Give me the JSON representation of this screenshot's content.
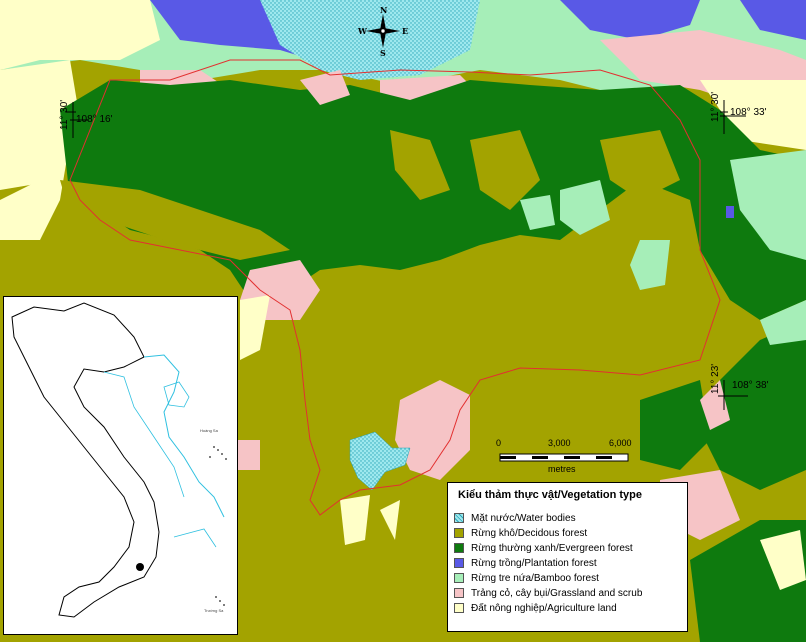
{
  "legend": {
    "title": "Kiểu thảm thực vật/Vegetation type",
    "items": [
      {
        "label": "Mặt nước/Water bodies",
        "color": "#9ee8ee",
        "pattern": "dotted"
      },
      {
        "label": "Rừng khô/Decidous forest",
        "color": "#a3a300"
      },
      {
        "label": "Rừng thường xanh/Evergreen forest",
        "color": "#0e7a0e"
      },
      {
        "label": "Rừng trồng/Plantation forest",
        "color": "#5959e6"
      },
      {
        "label": "Rừng tre nứa/Bamboo forest",
        "color": "#a6eeb8"
      },
      {
        "label": "Trảng cỏ, cây bụi/Grassland and scrub",
        "color": "#f6c4c6"
      },
      {
        "label": "Đất nông nghiệp/Agriculture land",
        "color": "#ffffc8"
      }
    ]
  },
  "coordinates": {
    "nw_lat": "11° 30'",
    "nw_lon": "108° 16'",
    "ne_lat": "11° 30'",
    "ne_lon": "108° 33'",
    "se_lat": "11° 23'",
    "se_lon": "108° 38'"
  },
  "scale": {
    "ticks": [
      "0",
      "3,000",
      "6,000"
    ],
    "unit": "metres"
  },
  "compass": {
    "n": "N",
    "s": "S",
    "e": "E",
    "w": "W"
  },
  "inset": {
    "note_top": "Hoàng Sa",
    "note_bottom": "Trường Sa"
  }
}
